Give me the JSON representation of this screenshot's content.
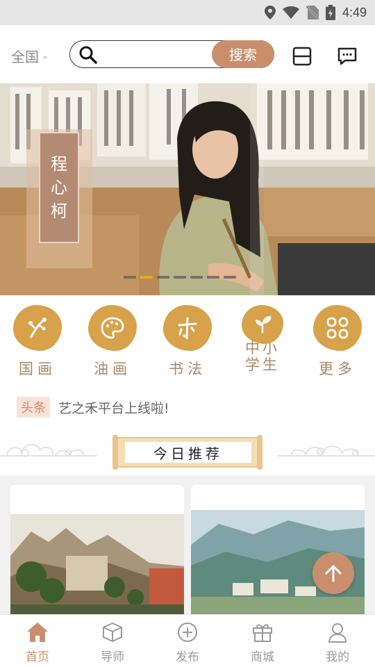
{
  "status_bar": {
    "time": "4:49"
  },
  "header": {
    "region": "全国",
    "search": {
      "placeholder": "",
      "button_label": "搜索"
    }
  },
  "banner": {
    "plaque_chars": [
      "程",
      "心",
      "柯"
    ],
    "dot_count": 7,
    "active_dot": 1
  },
  "categories": [
    {
      "label": "国画",
      "icon": "plum-blossom-icon"
    },
    {
      "label": "油画",
      "icon": "palette-icon"
    },
    {
      "label": "书法",
      "icon": "calligraphy-icon"
    },
    {
      "label": "中小学生",
      "icon": "sprout-icon"
    },
    {
      "label": "更多",
      "icon": "grid-icon"
    }
  ],
  "headline": {
    "tag": "头条",
    "text": "艺之禾平台上线啦!"
  },
  "recommend": {
    "title": "今日推荐"
  },
  "bottom_nav": [
    {
      "label": "首页",
      "icon": "home-icon",
      "active": true
    },
    {
      "label": "导师",
      "icon": "cube-icon",
      "active": false
    },
    {
      "label": "发布",
      "icon": "plus-circle-icon",
      "active": false
    },
    {
      "label": "商城",
      "icon": "gift-icon",
      "active": false
    },
    {
      "label": "我的",
      "icon": "user-icon",
      "active": false
    }
  ],
  "colors": {
    "accent": "#c98f6d",
    "gold": "#d7a24a",
    "dot_active": "#f2b21b"
  }
}
